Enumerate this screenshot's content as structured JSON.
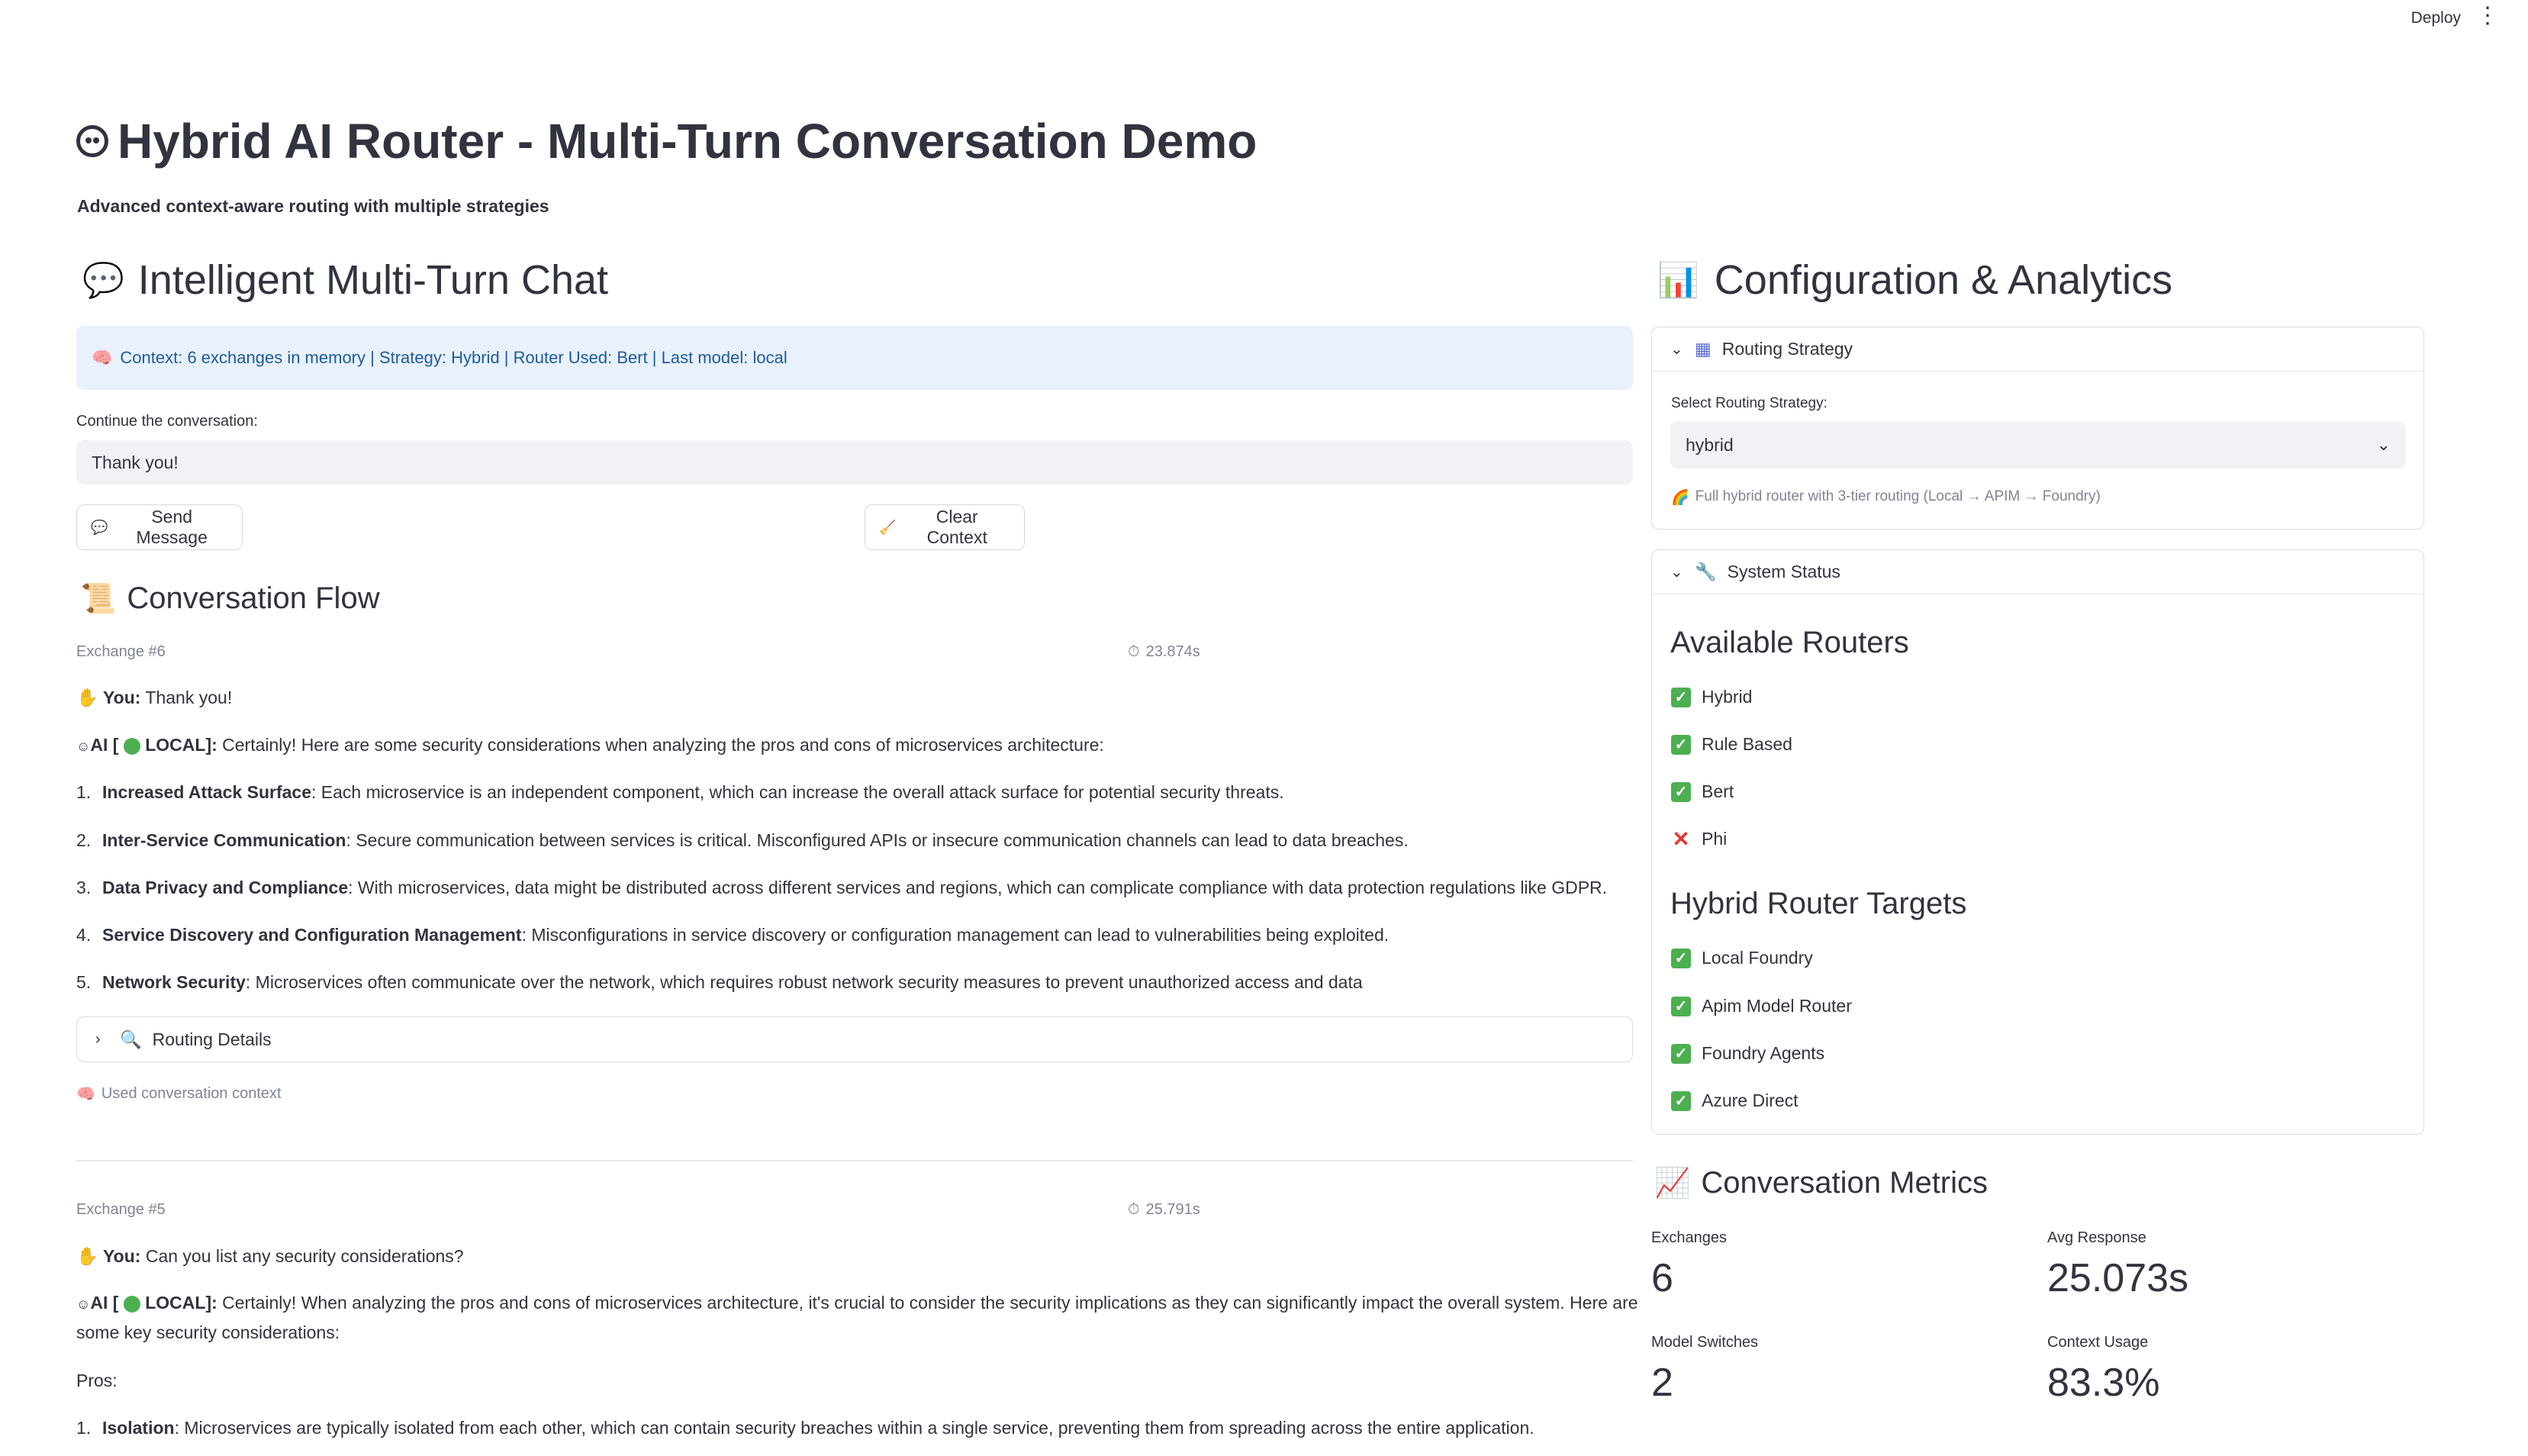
{
  "toolbar": {
    "deploy": "Deploy",
    "menu_icon": "⋮"
  },
  "header": {
    "title": "Hybrid AI Router - Multi-Turn Conversation Demo",
    "subtitle": "Advanced context-aware routing with multiple strategies"
  },
  "chat": {
    "heading": "Intelligent Multi-Turn Chat",
    "context_info": "Context: 6 exchanges in memory | Strategy: Hybrid | Router Used: Bert | Last model: local",
    "input_label": "Continue the conversation:",
    "input_value": "Thank you!",
    "send_label": "Send Message",
    "clear_label": "Clear Context"
  },
  "flow": {
    "heading": "Conversation Flow",
    "exchanges": [
      {
        "label": "Exchange #6",
        "time": "23.874s",
        "you_prefix": "You:",
        "you_text": "Thank you!",
        "ai_prefix": "AI [",
        "ai_model": "LOCAL]:",
        "ai_text": "Certainly! Here are some security considerations when analyzing the pros and cons of microservices architecture:",
        "items": [
          {
            "num": "1.",
            "bold": "Increased Attack Surface",
            "text": ": Each microservice is an independent component, which can increase the overall attack surface for potential security threats."
          },
          {
            "num": "2.",
            "bold": "Inter-Service Communication",
            "text": ": Secure communication between services is critical. Misconfigured APIs or insecure communication channels can lead to data breaches."
          },
          {
            "num": "3.",
            "bold": "Data Privacy and Compliance",
            "text": ": With microservices, data might be distributed across different services and regions, which can complicate compliance with data protection regulations like GDPR."
          },
          {
            "num": "4.",
            "bold": "Service Discovery and Configuration Management",
            "text": ": Misconfigurations in service discovery or configuration management can lead to vulnerabilities being exploited."
          },
          {
            "num": "5.",
            "bold": "Network Security",
            "text": ": Microservices often communicate over the network, which requires robust network security measures to prevent unauthorized access and data"
          }
        ],
        "routing_details": "Routing Details",
        "context_note": "Used conversation context"
      },
      {
        "label": "Exchange #5",
        "time": "25.791s",
        "you_prefix": "You:",
        "you_text": "Can you list any security considerations?",
        "ai_prefix": "AI [",
        "ai_model": "LOCAL]:",
        "ai_text_line1": "Certainly! When analyzing the pros and cons of microservices architecture, it's crucial to consider the security implications as they can significantly impact the overall system. Here are",
        "ai_text_line2": "some key security considerations:",
        "pros": "Pros:",
        "items": [
          {
            "num": "1.",
            "bold": "Isolation",
            "text": ": Microservices are typically isolated from each other, which can contain security breaches within a single service, preventing them from spreading across the entire application."
          }
        ]
      }
    ]
  },
  "config": {
    "heading": "Configuration & Analytics",
    "routing_strategy": {
      "title": "Routing Strategy",
      "select_label": "Select Routing Strategy:",
      "selected": "hybrid",
      "note": "Full hybrid router with 3-tier routing (Local → APIM → Foundry)"
    },
    "system_status": {
      "title": "System Status",
      "routers_heading": "Available Routers",
      "routers": [
        {
          "name": "Hybrid",
          "ok": true
        },
        {
          "name": "Rule Based",
          "ok": true
        },
        {
          "name": "Bert",
          "ok": true
        },
        {
          "name": "Phi",
          "ok": false
        }
      ],
      "targets_heading": "Hybrid Router Targets",
      "targets": [
        {
          "name": "Local Foundry",
          "ok": true
        },
        {
          "name": "Apim Model Router",
          "ok": true
        },
        {
          "name": "Foundry Agents",
          "ok": true
        },
        {
          "name": "Azure Direct",
          "ok": true
        }
      ]
    }
  },
  "metrics": {
    "heading": "Conversation Metrics",
    "exchanges_label": "Exchanges",
    "exchanges_value": "6",
    "avg_label": "Avg Response",
    "avg_value": "25.073s",
    "switches_label": "Model Switches",
    "switches_value": "2",
    "context_label": "Context Usage",
    "context_value": "83.3%"
  },
  "colors": {
    "accent_blue": "#1f5b9c",
    "info_bg": "#e8f1fc",
    "check_green": "#4caf50",
    "x_red": "#e53935"
  }
}
